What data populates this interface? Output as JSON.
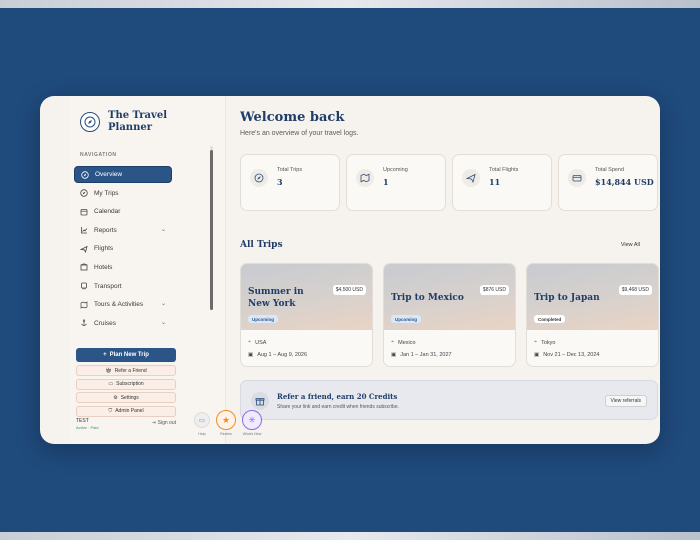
{
  "brand": {
    "name": "The Travel Planner"
  },
  "sidebar": {
    "heading": "NAVIGATION",
    "items": [
      {
        "label": "Overview",
        "icon": "compass-icon",
        "active": true
      },
      {
        "label": "My Trips",
        "icon": "compass-icon"
      },
      {
        "label": "Calendar",
        "icon": "calendar-icon"
      },
      {
        "label": "Reports",
        "icon": "reports-icon",
        "expandable": true
      },
      {
        "label": "Flights",
        "icon": "plane-icon"
      },
      {
        "label": "Hotels",
        "icon": "hotel-icon"
      },
      {
        "label": "Transport",
        "icon": "transport-icon"
      },
      {
        "label": "Tours & Activities",
        "icon": "map-icon",
        "expandable": true
      },
      {
        "label": "Cruises",
        "icon": "anchor-icon",
        "expandable": true
      }
    ],
    "actions": {
      "plan": "Plan New Trip",
      "refer": "Refer a Friend",
      "subscription": "Subscription",
      "settings": "Settings",
      "admin": "Admin Panel"
    },
    "user": {
      "name": "TEST",
      "status": "Active · Paid",
      "signout": "Sign out"
    }
  },
  "main": {
    "welcome": "Welcome back",
    "subtitle": "Here's an overview of your travel logs.",
    "stats": [
      {
        "label": "Total Trips",
        "value": "3",
        "icon": "compass-icon"
      },
      {
        "label": "Upcoming",
        "value": "1",
        "icon": "map-icon"
      },
      {
        "label": "Total Flights",
        "value": "11",
        "icon": "plane-icon"
      },
      {
        "label": "Total Spend",
        "value": "$14,844 USD",
        "icon": "card-icon"
      }
    ],
    "all_trips": "All Trips",
    "view_all": "View All",
    "trips": [
      {
        "name": "Summer in New York",
        "price": "$4,500 USD",
        "status": "Upcoming",
        "status_kind": "upcoming",
        "location": "USA",
        "dates": "Aug 1 – Aug 9, 2026"
      },
      {
        "name": "Trip to Mexico",
        "price": "$876 USD",
        "status": "Upcoming",
        "status_kind": "upcoming",
        "location": "Mexico",
        "dates": "Jan 1 – Jan 31, 2027"
      },
      {
        "name": "Trip to Japan",
        "price": "$9,468 USD",
        "status": "Completed",
        "status_kind": "completed",
        "location": "Tokyo",
        "dates": "Nov 21 – Dec 13, 2024"
      }
    ],
    "referral": {
      "title": "Refer a friend, earn 20 Credits",
      "text": "Share your link and earn credit when friends subscribe.",
      "button": "View referrals"
    }
  },
  "fabs": {
    "help": "Help",
    "rate": "Review",
    "new": "What's New"
  },
  "colors": {
    "primary": "#2c5587",
    "background": "#1f4a7c",
    "accent_orange": "#f08b2c",
    "accent_purple": "#8c6be0"
  }
}
